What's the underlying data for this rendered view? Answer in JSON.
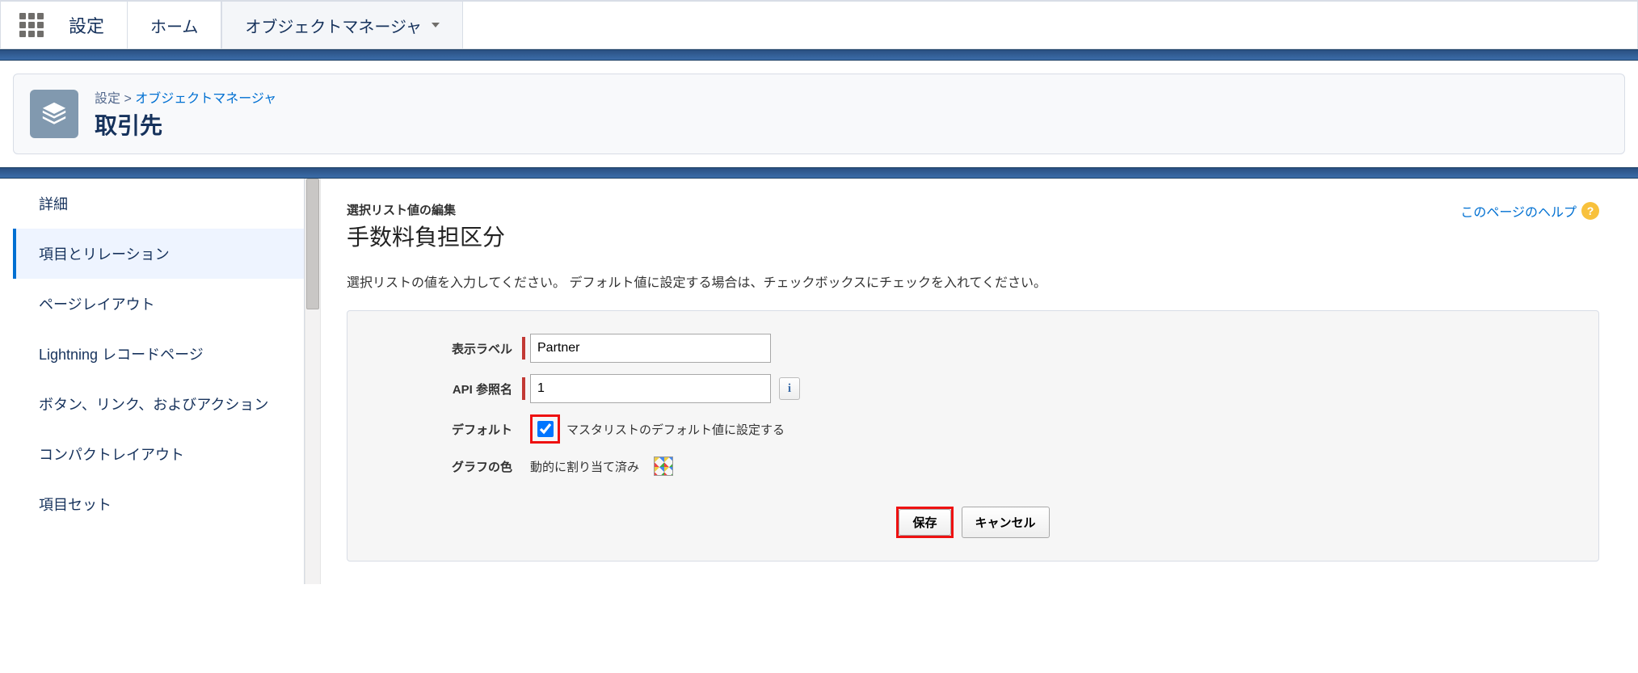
{
  "topbar": {
    "app_title": "設定",
    "tabs": [
      {
        "label": "ホーム",
        "active": false
      },
      {
        "label": "オブジェクトマネージャ",
        "active": true,
        "has_dropdown": true
      }
    ]
  },
  "header": {
    "breadcrumb_root": "設定",
    "breadcrumb_link": "オブジェクトマネージャ",
    "title": "取引先"
  },
  "sidebar": {
    "items": [
      {
        "label": "詳細",
        "active": false
      },
      {
        "label": "項目とリレーション",
        "active": true
      },
      {
        "label": "ページレイアウト",
        "active": false
      },
      {
        "label": "Lightning レコードページ",
        "active": false
      },
      {
        "label": "ボタン、リンク、およびアクション",
        "active": false
      },
      {
        "label": "コンパクトレイアウト",
        "active": false
      },
      {
        "label": "項目セット",
        "active": false
      }
    ]
  },
  "main": {
    "mini_title": "選択リスト値の編集",
    "page_title": "手数料負担区分",
    "help_link": "このページのヘルプ",
    "instructions": "選択リストの値を入力してください。 デフォルト値に設定する場合は、チェックボックスにチェックを入れてください。",
    "form": {
      "label_display": "表示ラベル",
      "value_display": "Partner",
      "label_api": "API 参照名",
      "value_api": "1",
      "label_default": "デフォルト",
      "checkbox_label": "マスタリストのデフォルト値に設定する",
      "checkbox_checked": true,
      "label_color": "グラフの色",
      "color_text": "動的に割り当て済み"
    },
    "buttons": {
      "save": "保存",
      "cancel": "キャンセル"
    }
  }
}
